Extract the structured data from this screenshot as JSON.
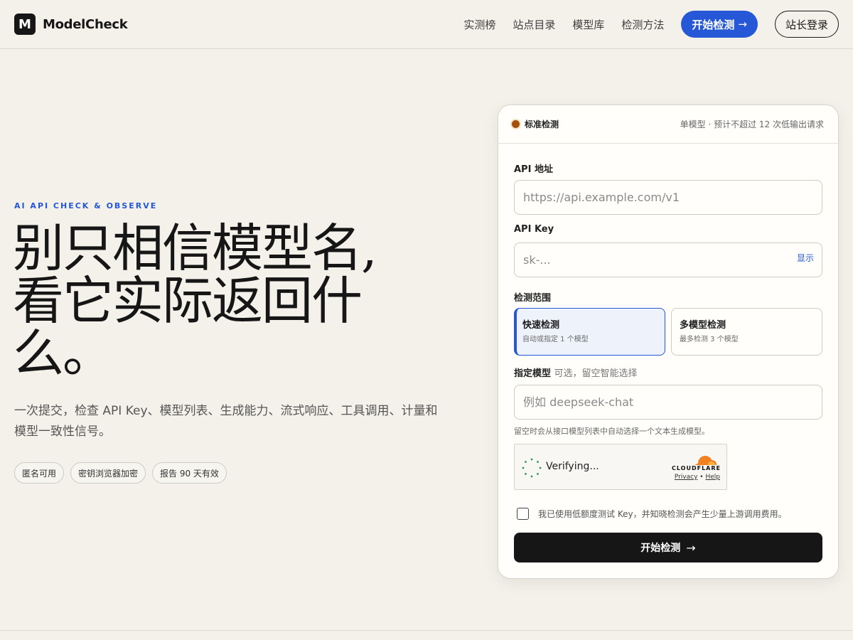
{
  "brand": {
    "mark": "M",
    "name": "ModelCheck"
  },
  "nav": {
    "links": [
      "实测榜",
      "站点目录",
      "模型库",
      "检测方法"
    ],
    "cta_label": "开始检测",
    "cta_arrow": "→",
    "login_label": "站长登录"
  },
  "hero": {
    "eyebrow": "AI API CHECK & OBSERVE",
    "title_lines": [
      "别只相信模型名,",
      "看它实际返回什",
      "么。"
    ],
    "subtitle": "一次提交，检查 API Key、模型列表、生成能力、流式响应、工具调用、计量和模型一致性信号。",
    "chips": [
      "匿名可用",
      "密钥浏览器加密",
      "报告 90 天有效"
    ]
  },
  "card": {
    "mode_label": "标准检测",
    "mode_note": "单模型 · 预计不超过 12 次低输出请求",
    "status_color": "#a3500e",
    "api_url": {
      "label": "API 地址",
      "placeholder": "https://api.example.com/v1",
      "value": ""
    },
    "api_key": {
      "label": "API Key",
      "placeholder": "sk-...",
      "value": "",
      "toggle": "显示"
    },
    "scope": {
      "label": "检测范围",
      "options": [
        {
          "title": "快速检测",
          "desc": "自动或指定 1 个模型",
          "selected": true
        },
        {
          "title": "多模型检测",
          "desc": "最多检测 3 个模型",
          "selected": false
        }
      ]
    },
    "model": {
      "label": "指定模型",
      "label_note": "可选，留空智能选择",
      "placeholder": "例如 deepseek-chat",
      "value": "",
      "hint": "留空时会从接口模型列表中自动选择一个文本生成模型。"
    },
    "captcha": {
      "status": "Verifying...",
      "provider": "CLOUDFLARE",
      "privacy": "Privacy",
      "separator": "•",
      "help": "Help"
    },
    "consent": {
      "checked": false,
      "text": "我已使用低额度测试 Key，并知晓检测会产生少量上游调用费用。"
    },
    "submit_label": "开始检测",
    "submit_arrow": "→"
  },
  "colors": {
    "accent": "#2557d6",
    "background": "#f4f1ea",
    "dark": "#161616",
    "cloudflare_orange": "#f38020"
  }
}
